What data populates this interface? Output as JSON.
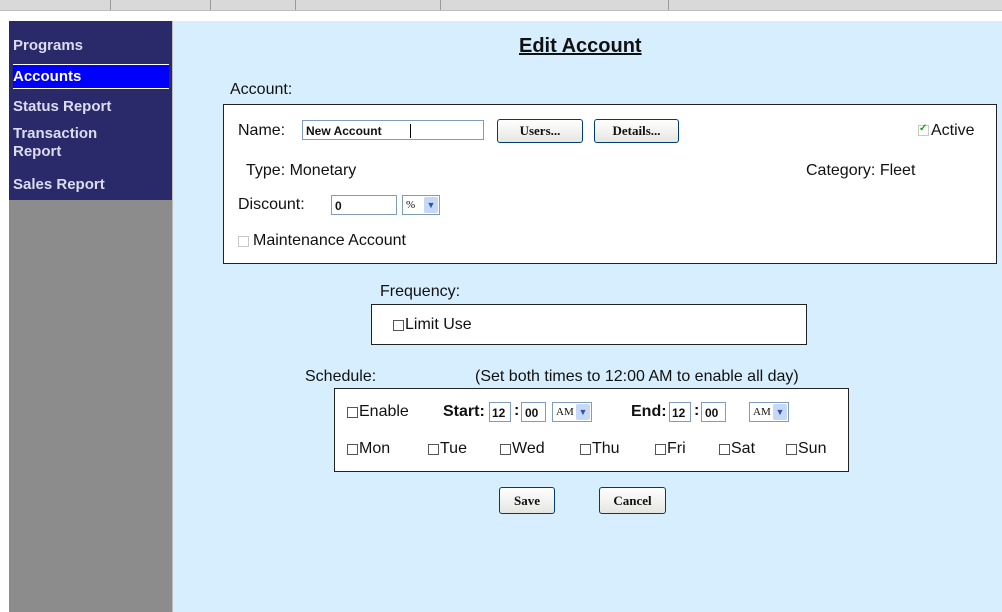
{
  "sidebar": {
    "items": [
      {
        "label": "Programs"
      },
      {
        "label": "Accounts"
      },
      {
        "label": "Status Report"
      },
      {
        "label": "Transaction"
      },
      {
        "label": "Report"
      },
      {
        "label": "Sales Report"
      }
    ]
  },
  "page": {
    "title": "Edit Account"
  },
  "account": {
    "section_label": "Account:",
    "name_label": "Name:",
    "name_value": "New Account",
    "users_button": "Users...",
    "details_button": "Details...",
    "active_label": "Active",
    "active_checked": true,
    "type_text": "Type: Monetary",
    "category_text": "Category: Fleet",
    "discount_label": "Discount:",
    "discount_value": "0",
    "discount_unit": "%",
    "maintenance_label": "Maintenance Account"
  },
  "frequency": {
    "section_label": "Frequency:",
    "limit_use_label": "Limit Use"
  },
  "schedule": {
    "section_label": "Schedule:",
    "hint": "(Set both times to 12:00 AM to enable all day)",
    "enable_label": "Enable",
    "start_label": "Start:",
    "start_hour": "12",
    "start_min": "00",
    "start_ampm": "AM",
    "end_label": "End:",
    "end_hour": "12",
    "end_min": "00",
    "end_ampm": "AM",
    "time_separator": ":",
    "days": [
      "Mon",
      "Tue",
      "Wed",
      "Thu",
      "Fri",
      "Sat",
      "Sun"
    ]
  },
  "actions": {
    "save": "Save",
    "cancel": "Cancel"
  },
  "icons": {
    "dropdown": "chevron-down-icon",
    "checkbox": "checkbox-icon"
  }
}
